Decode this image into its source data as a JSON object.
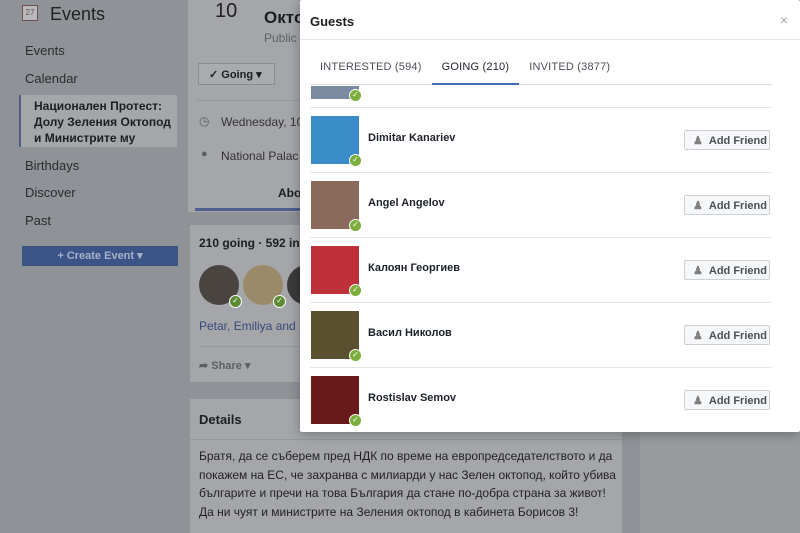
{
  "sidebar": {
    "title": "Events",
    "calendar_day": "27",
    "items": [
      "Events",
      "Calendar",
      "Национален Протест: Долу Зеления Октопод и Министрите му",
      "Birthdays",
      "Discover",
      "Past"
    ],
    "create_event": "Create Event"
  },
  "event": {
    "day": "10",
    "title": "Октo",
    "privacy": "Public",
    "going_button": "Going",
    "date": "Wednesday, 10",
    "location": "National Palac",
    "tab_about": "Abo",
    "going_summary": "210 going · 592 in",
    "friends_going": "Petar, Emiliya and",
    "share": "Share",
    "details_title": "Details",
    "details_text": "Братя, да се съберем пред НДК по време на европредседателството и да покажем на ЕС, че захранва с милиарди у нас Зелен октопод, който убива българите и пречи на това България да стане по-добра страна за живот! Да ни чуят и министрите на Зеления октопод в кабинета Борисов 3!"
  },
  "modal": {
    "title": "Guests",
    "close": "×",
    "tabs": [
      {
        "label": "INTERESTED (594)"
      },
      {
        "label": "GOING (210)",
        "active": true
      },
      {
        "label": "INVITED (3877)"
      }
    ],
    "add_friend": "Add Friend",
    "guests": [
      {
        "name": "Dimitar Kanariev",
        "color": "#3a8cc8"
      },
      {
        "name": "Angel Angelov",
        "color": "#8a6a5a"
      },
      {
        "name": "Калоян Георгиев",
        "color": "#c0303a"
      },
      {
        "name": "Васил Николов",
        "color": "#5a5030"
      },
      {
        "name": "Rostislav Semov",
        "color": "#6a1a1a"
      }
    ]
  },
  "colors": {
    "accent": "#4267b2",
    "check": "#7cae3b"
  }
}
